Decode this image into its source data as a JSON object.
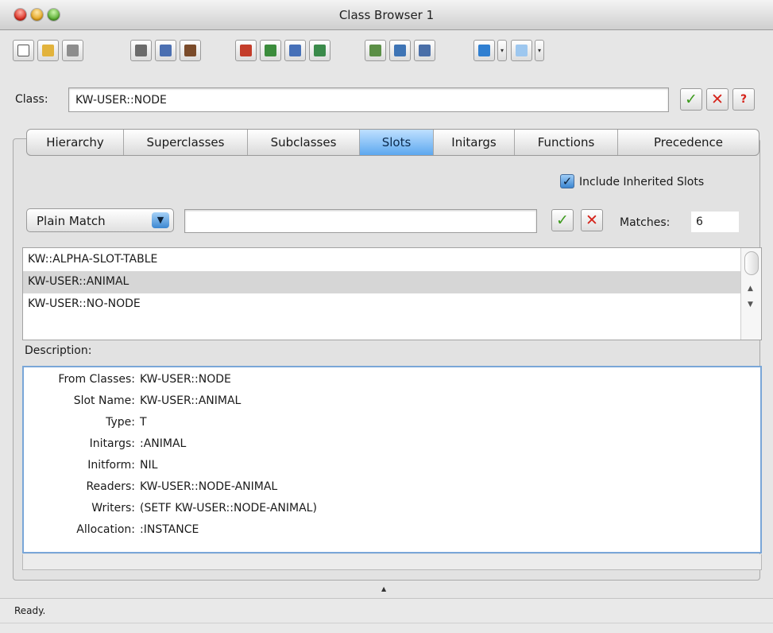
{
  "window": {
    "title": "Class Browser 1"
  },
  "toolbar": {
    "buttons": [
      {
        "name": "new-document-icon",
        "color": "#ffffff"
      },
      {
        "name": "open-folder-icon",
        "color": "#e2b33c"
      },
      {
        "name": "save-disk-icon",
        "color": "#8d8d8d"
      },
      {
        "name": "cut-scissors-icon",
        "color": "#6b6b6b"
      },
      {
        "name": "copy-icon",
        "color": "#4b6fb1"
      },
      {
        "name": "paste-clipboard-icon",
        "color": "#7a4b2a"
      },
      {
        "name": "inspect-icon",
        "color": "#c43d2a"
      },
      {
        "name": "browse-icon",
        "color": "#3b8c3c"
      },
      {
        "name": "edit-icon",
        "color": "#4670b8"
      },
      {
        "name": "graph-icon",
        "color": "#3a8a4a"
      },
      {
        "name": "file-icon",
        "color": "#5b8f46"
      },
      {
        "name": "list-icon",
        "color": "#3e74b5"
      },
      {
        "name": "search-window-icon",
        "color": "#4a6fa8"
      },
      {
        "name": "back-arrow-icon",
        "color": "#2f7fd1"
      },
      {
        "name": "forward-arrow-icon",
        "color": "#9dc7ef"
      }
    ]
  },
  "class_field": {
    "label": "Class:",
    "value": "KW-USER::NODE"
  },
  "tabs": [
    {
      "label": "Hierarchy",
      "active": false
    },
    {
      "label": "Superclasses",
      "active": false
    },
    {
      "label": "Subclasses",
      "active": false
    },
    {
      "label": "Slots",
      "active": true
    },
    {
      "label": "Initargs",
      "active": false
    },
    {
      "label": "Functions",
      "active": false
    },
    {
      "label": "Precedence",
      "active": false
    }
  ],
  "include_inherited": {
    "label": "Include Inherited Slots",
    "checked": true
  },
  "filter": {
    "mode": "Plain Match",
    "text": "",
    "matches_label": "Matches:",
    "matches_value": "6"
  },
  "slots": [
    {
      "name": "KW::ALPHA-SLOT-TABLE",
      "selected": false
    },
    {
      "name": "KW-USER::ANIMAL",
      "selected": true
    },
    {
      "name": "KW-USER::NO-NODE",
      "selected": false
    }
  ],
  "description": {
    "label": "Description:",
    "rows": [
      {
        "label": "From Classes:",
        "value": "KW-USER::NODE"
      },
      {
        "label": "Slot Name:",
        "value": "KW-USER::ANIMAL"
      },
      {
        "label": "Type:",
        "value": "T"
      },
      {
        "label": "Initargs:",
        "value": ":ANIMAL"
      },
      {
        "label": "Initform:",
        "value": "NIL"
      },
      {
        "label": "Readers:",
        "value": "KW-USER::NODE-ANIMAL"
      },
      {
        "label": "Writers:",
        "value": "(SETF KW-USER::NODE-ANIMAL)"
      },
      {
        "label": "Allocation:",
        "value": ":INSTANCE"
      }
    ]
  },
  "status": {
    "text": "Ready."
  }
}
